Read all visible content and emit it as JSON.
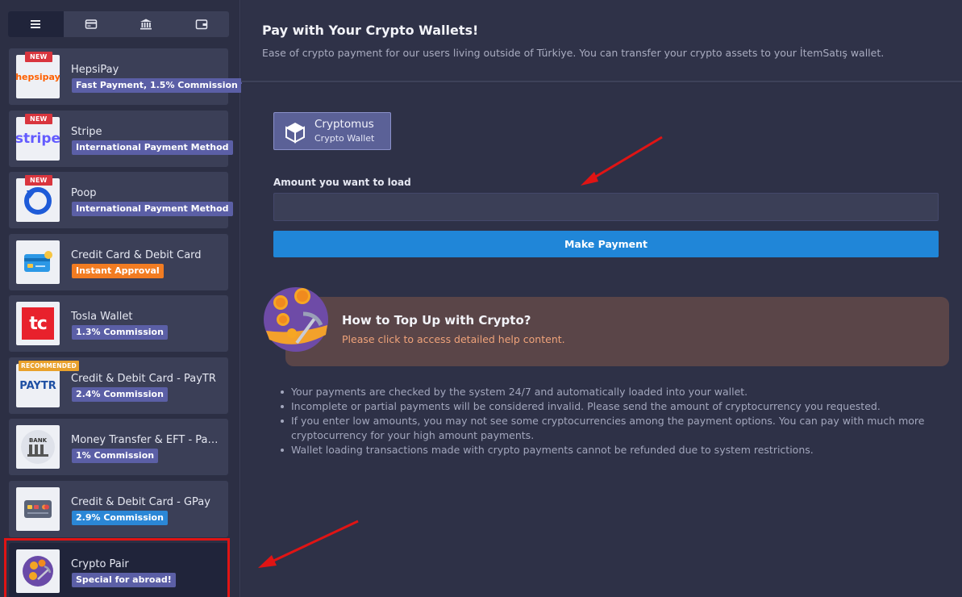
{
  "sidebar": {
    "tabs": [
      {
        "icon": "menu-icon",
        "active": true
      },
      {
        "icon": "credit-card-icon",
        "active": false
      },
      {
        "icon": "bank-icon",
        "active": false
      },
      {
        "icon": "wallet-icon",
        "active": false
      }
    ],
    "methods": [
      {
        "name": "HepsiPay",
        "badge": "Fast Payment, 1.5% Commission",
        "ribbon": "NEW",
        "logo_text": "hepsipay"
      },
      {
        "name": "Stripe",
        "badge": "International Payment Method",
        "ribbon": "NEW",
        "logo_text": "stripe"
      },
      {
        "name": "Poop",
        "badge": "International Payment Method",
        "ribbon": "NEW"
      },
      {
        "name": "Credit Card & Debit Card",
        "badge": "Instant Approval"
      },
      {
        "name": "Tosla Wallet",
        "badge": "1.3% Commission",
        "logo_text": "tc"
      },
      {
        "name": "Credit & Debit Card - PayTR",
        "badge": "2.4% Commission",
        "ribbon": "RECOMMENDED",
        "logo_text": "PAYTR"
      },
      {
        "name": "Money Transfer & EFT - Pay…",
        "badge": "1% Commission",
        "logo_text": "BANK"
      },
      {
        "name": "Credit & Debit Card - GPay",
        "badge": "2.9% Commission"
      },
      {
        "name": "Crypto Pair",
        "badge": "Special for abroad!"
      }
    ]
  },
  "header": {
    "title": "Pay with Your Crypto Wallets!",
    "subtitle": "Ease of crypto payment for our users living outside of Türkiye. You can transfer your crypto assets to your İtemSatış wallet."
  },
  "wallet": {
    "name": "Cryptomus",
    "sub": "Crypto Wallet"
  },
  "form": {
    "amount_label": "Amount you want to load",
    "amount_value": "",
    "submit_label": "Make Payment"
  },
  "help": {
    "title": "How to Top Up with Crypto?",
    "subtitle": "Please click to access detailed help content."
  },
  "notes": [
    "Your payments are checked by the system 24/7 and automatically loaded into your wallet.",
    "Incomplete or partial payments will be considered invalid. Please send the amount of cryptocurrency you requested.",
    "If you enter low amounts, you may not see some cryptocurrencies among the payment options. You can pay with much more cryptocurrency for your high amount payments.",
    "Wallet loading transactions made with crypto payments cannot be refunded due to system restrictions."
  ],
  "colors": {
    "accent": "#2086d8",
    "badge": "#5b5fa6",
    "orange": "#f27c22",
    "new_ribbon": "#d9353e",
    "highlight": "#e01414"
  }
}
